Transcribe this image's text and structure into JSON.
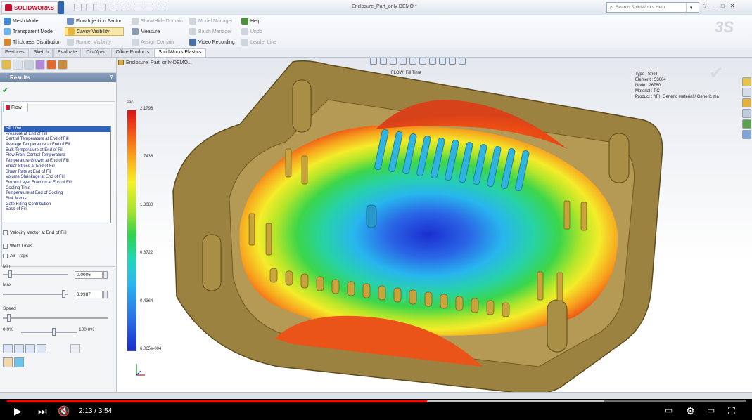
{
  "app": {
    "brand": "SOLIDWORKS",
    "document_title": "Enclosure_Part_only-DEMO *",
    "search_placeholder": "Search SolidWorks Help"
  },
  "ribbon": {
    "col1": [
      "Mesh Model",
      "Transparent Model",
      "Thickness Distribution"
    ],
    "col2": [
      "Flow Injection Factor",
      "Cavity Visibility",
      "Runner Visibility"
    ],
    "col3": [
      "Show/Hide Domain",
      "Measure",
      "Assign Domain"
    ],
    "col4": [
      "Model Manager",
      "Batch Manager",
      "Video Recording"
    ],
    "col5": [
      "Help",
      "Undo",
      "Leader Line"
    ]
  },
  "tabs": [
    "Features",
    "Sketch",
    "Evaluate",
    "DimXpert",
    "Office Products",
    "SolidWorks Plastics"
  ],
  "active_tab": "SolidWorks Plastics",
  "left_panel": {
    "header": "Results",
    "help": "?",
    "flow_tab": "Flow",
    "results_list": [
      "Fill Time",
      "Pressure at End of Fill",
      "Central Temperature at End of Fill",
      "Average Temperature at End of Fill",
      "Bulk Temperature at End of Fill",
      "Flow Front Central Temperature",
      "Temperature Growth at End of Fill",
      "Shear Stress at End of Fill",
      "Shear Rate at End of Fill",
      "Volume Shrinkage at End of Fill",
      "Frozen Layer Fraction at End of Fill",
      "Cooling Time",
      "Temperature at End of Cooling",
      "Sink Marks",
      "Gate Filling Contribution",
      "Ease of Fill"
    ],
    "velocity_vector": "Velocity Vector at End of Fill",
    "weld_lines": "Weld Lines",
    "air_traps": "Air Traps",
    "min_label": "Min",
    "min_value": "0.0006",
    "max_label": "Max",
    "max_value": "3.9987",
    "speed_label": "Speed",
    "pct_start": "0.0%",
    "pct_end": "100.0%"
  },
  "graphics": {
    "tree_node": "Enclosure_Part_only-DEMO...",
    "plot_title": "FLOW: Fill Time",
    "units": "sec",
    "legend_values": [
      "2.1796",
      "1.7438",
      "1.3080",
      "0.8722",
      "0.4364",
      "6.065e-004"
    ],
    "info": {
      "type": "Type : Shell",
      "element": "Element : 53664",
      "node": "Node : 26780",
      "material": "Material : PC",
      "product": "Product : \"(F): Generic material / Generic ma"
    }
  },
  "video": {
    "time": "2:13 / 3:54",
    "progress": 0.569
  }
}
